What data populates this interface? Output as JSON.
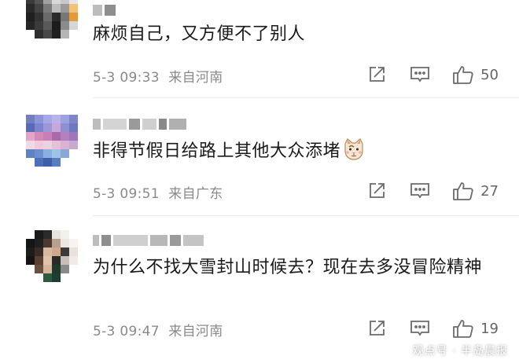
{
  "comments": [
    {
      "text": "麻烦自己，又方便不了别人",
      "date": "5-3 09:33",
      "location": "来自河南",
      "likes": "50"
    },
    {
      "text": "非得节假日给路上其他大众添堵",
      "date": "5-3 09:51",
      "location": "来自广东",
      "likes": "27"
    },
    {
      "text": "为什么不找大雪封山时候去？现在去多没冒险精神",
      "date": "5-3 09:47",
      "location": "来自河南",
      "likes": "19"
    }
  ],
  "watermark": "观点号 · 半岛晨报",
  "icons": {
    "share": "share-icon",
    "comment": "comment-icon",
    "like": "thumbs-up-icon",
    "emoji": "cat-face-emoji-icon"
  },
  "colors": {
    "text": "#1a1a1a",
    "meta": "#8a8a8a",
    "icon": "#6b6b6b"
  }
}
